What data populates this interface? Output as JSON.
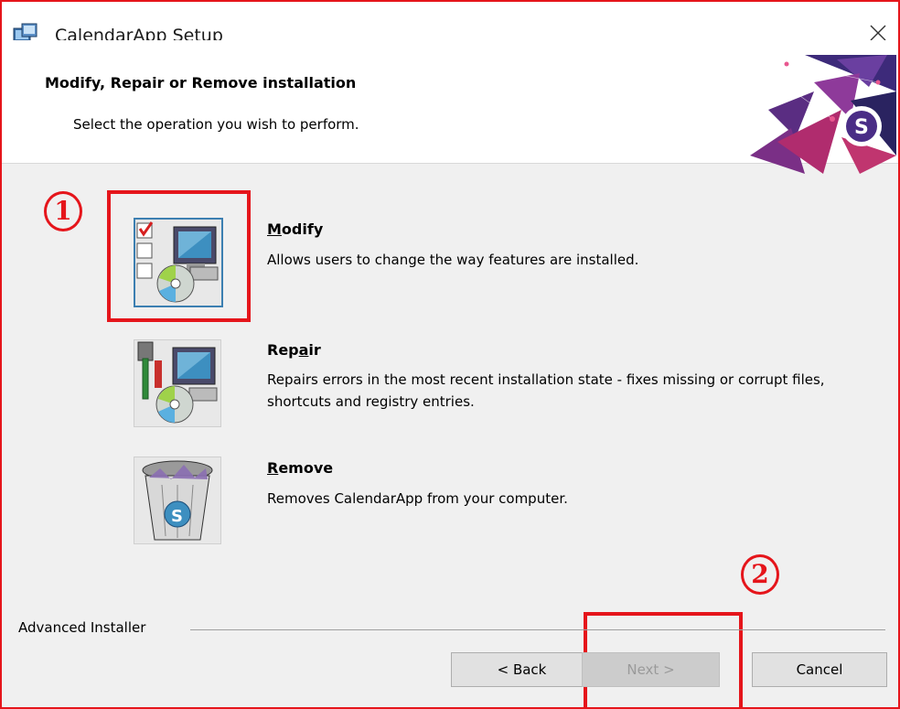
{
  "window": {
    "title": "CalendarApp Setup"
  },
  "header": {
    "title": "Modify, Repair or Remove installation",
    "subtitle": "Select the operation you wish to perform."
  },
  "options": [
    {
      "title_pre": "",
      "title_key": "M",
      "title_post": "odify",
      "description": "Allows users to change the way features are installed.",
      "selected": true
    },
    {
      "title_pre": "Rep",
      "title_key": "a",
      "title_post": "ir",
      "description": "Repairs errors in the most recent installation state - fixes missing or corrupt files, shortcuts and registry entries.",
      "selected": false
    },
    {
      "title_pre": "",
      "title_key": "R",
      "title_post": "emove",
      "description": "Removes CalendarApp from your computer.",
      "selected": false
    }
  ],
  "footer": {
    "brand": "Advanced Installer"
  },
  "buttons": {
    "back": "< Back",
    "next": "Next >",
    "cancel": "Cancel"
  },
  "annotations": {
    "step1": "1",
    "step2": "2"
  },
  "colors": {
    "annotation": "#e5151b",
    "selection": "#3c7fb1",
    "dialog_bg": "#f0f0f0"
  }
}
